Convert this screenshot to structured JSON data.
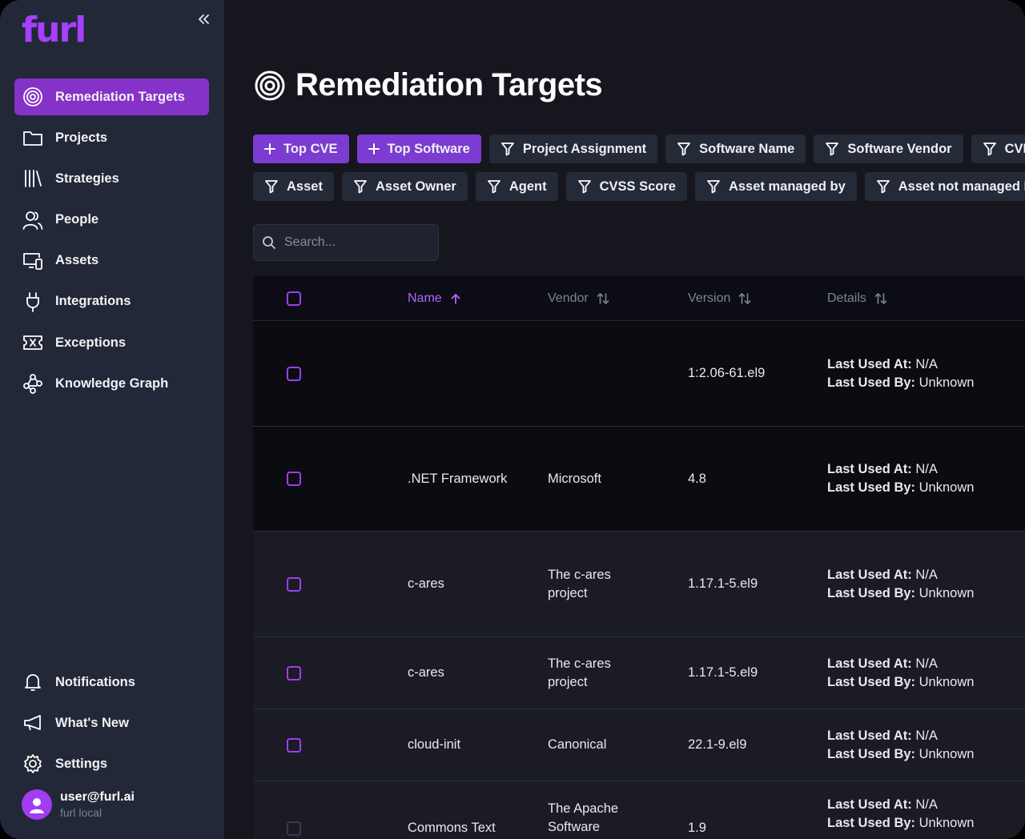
{
  "app": {
    "logo": "furl"
  },
  "sidebar": {
    "items": [
      {
        "label": "Remediation Targets",
        "icon": "target-icon",
        "active": true
      },
      {
        "label": "Projects",
        "icon": "folder-icon"
      },
      {
        "label": "Strategies",
        "icon": "library-icon"
      },
      {
        "label": "People",
        "icon": "people-icon"
      },
      {
        "label": "Assets",
        "icon": "devices-icon"
      },
      {
        "label": "Integrations",
        "icon": "plug-icon"
      },
      {
        "label": "Exceptions",
        "icon": "ticket-x-icon"
      },
      {
        "label": "Knowledge Graph",
        "icon": "graph-icon"
      }
    ],
    "bottom_items": [
      {
        "label": "Notifications",
        "icon": "bell-icon"
      },
      {
        "label": "What's New",
        "icon": "megaphone-icon"
      },
      {
        "label": "Settings",
        "icon": "gear-icon"
      }
    ],
    "user": {
      "email": "user@furl.ai",
      "org": "furl local"
    }
  },
  "page": {
    "title": "Remediation Targets"
  },
  "filters": {
    "row1": [
      {
        "label": "Top CVE",
        "kind": "add"
      },
      {
        "label": "Top Software",
        "kind": "add"
      },
      {
        "label": "Project Assignment",
        "kind": "filter"
      },
      {
        "label": "Software Name",
        "kind": "filter"
      },
      {
        "label": "Software Vendor",
        "kind": "filter"
      },
      {
        "label": "CVE",
        "kind": "filter"
      }
    ],
    "row2": [
      {
        "label": "Asset"
      },
      {
        "label": "Asset Owner"
      },
      {
        "label": "Agent"
      },
      {
        "label": "CVSS Score"
      },
      {
        "label": "Asset managed by"
      },
      {
        "label": "Asset not managed by"
      }
    ]
  },
  "search": {
    "placeholder": "Search..."
  },
  "table": {
    "columns": [
      "Name",
      "Vendor",
      "Version",
      "Details"
    ],
    "details_labels": {
      "last_used_at": "Last Used At:",
      "last_used_by": "Last Used By:"
    },
    "rows": [
      {
        "name": "",
        "vendor": "",
        "version": "1:2.06-61.el9",
        "last_used_at": "N/A",
        "last_used_by": "Unknown"
      },
      {
        "name": ".NET Framework",
        "vendor": "Microsoft",
        "version": "4.8",
        "last_used_at": "N/A",
        "last_used_by": "Unknown"
      },
      {
        "name": "c-ares",
        "vendor": "The c-ares project",
        "version": "1.17.1-5.el9",
        "last_used_at": "N/A",
        "last_used_by": "Unknown"
      },
      {
        "name": "c-ares",
        "vendor": "The c-ares project",
        "version": "1.17.1-5.el9",
        "last_used_at": "N/A",
        "last_used_by": "Unknown"
      },
      {
        "name": "cloud-init",
        "vendor": "Canonical",
        "version": "22.1-9.el9",
        "last_used_at": "N/A",
        "last_used_by": "Unknown"
      },
      {
        "name": "Commons Text",
        "vendor": "The Apache Software",
        "version": "1.9",
        "last_used_at": "N/A",
        "last_used_by": "Unknown"
      }
    ]
  },
  "colors": {
    "accent": "#8532c8",
    "sidebar_bg": "#222838",
    "main_bg": "#16161f"
  }
}
